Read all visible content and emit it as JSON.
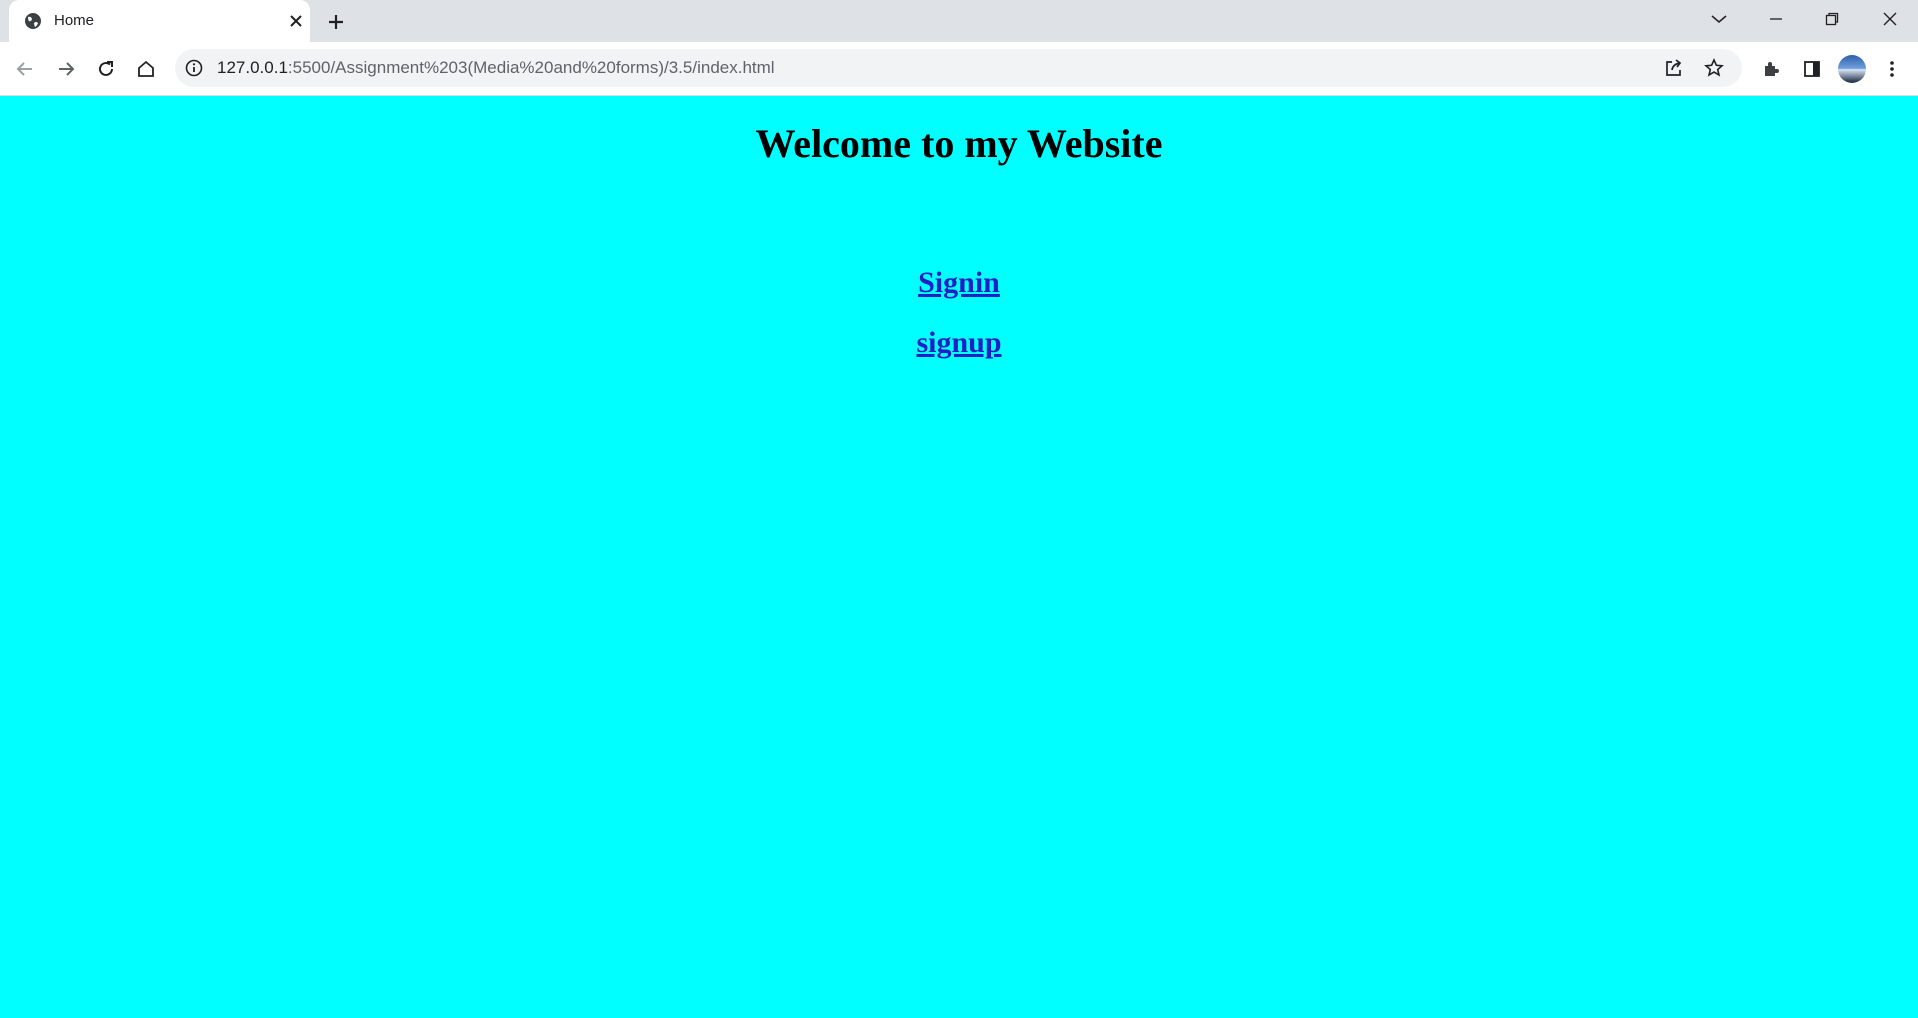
{
  "browser": {
    "tab": {
      "title": "Home",
      "favicon": "globe-icon",
      "close_icon": "close-icon"
    },
    "new_tab_icon": "plus-icon",
    "window_controls": [
      "chevron-down-icon",
      "minimize-icon",
      "restore-icon",
      "close-icon"
    ],
    "toolbar": {
      "icons": [
        "back-arrow-icon",
        "forward-arrow-icon",
        "reload-icon",
        "home-icon"
      ],
      "url_host": "127.0.0.1",
      "url_rest": ":5500/Assignment%203(Media%20and%20forms)/3.5/index.html",
      "right_icons": [
        "share-icon",
        "star-icon",
        "puzzle-icon",
        "side-panel-icon",
        "avatar",
        "kebab-menu-icon"
      ]
    }
  },
  "page": {
    "background": "#00ffff",
    "title": "Welcome to my Website",
    "links": [
      {
        "label": "Signin"
      },
      {
        "label": "signup"
      }
    ],
    "link_color": "#1f1fc8"
  }
}
